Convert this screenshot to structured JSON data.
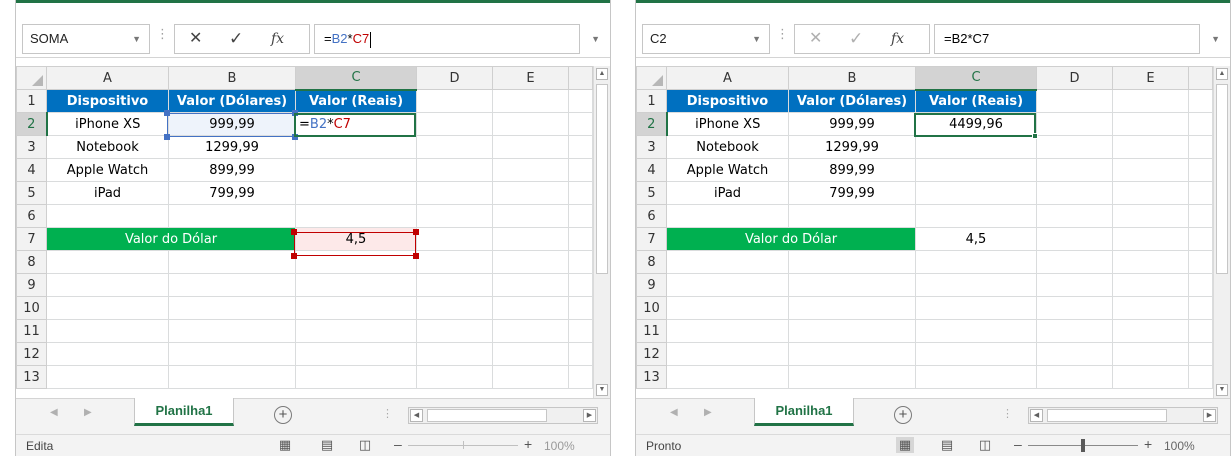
{
  "colors": {
    "excel_green": "#217346",
    "header_blue": "#0070c0",
    "dollar_green": "#00b050",
    "ref_blue": "#4472c4",
    "ref_red": "#c00000",
    "ref_red_fill": "#fde9e9"
  },
  "icons": [
    "cancel-icon",
    "enter-check-icon",
    "insert-function-icon",
    "expand-formula-bar-icon",
    "add-sheet-icon",
    "normal-view-icon",
    "page-layout-icon",
    "page-break-icon"
  ],
  "left": {
    "namebox": "SOMA",
    "formula_parts": [
      {
        "text": "=",
        "color": "#000000"
      },
      {
        "text": "B2",
        "color": "#4472c4"
      },
      {
        "text": "*",
        "color": "#000000"
      },
      {
        "text": "C7",
        "color": "#c00000"
      }
    ],
    "columns": [
      "A",
      "B",
      "C",
      "D",
      "E"
    ],
    "rows": [
      "1",
      "2",
      "3",
      "4",
      "5",
      "6",
      "7",
      "8",
      "9",
      "10",
      "11",
      "12",
      "13"
    ],
    "cells": {
      "a1": "Dispositivo",
      "b1": "Valor (Dólares)",
      "c1": "Valor (Reais)",
      "a2": "iPhone XS",
      "b2": "999,99",
      "c2_parts": [
        {
          "text": "=",
          "color": "#000000"
        },
        {
          "text": "B2",
          "color": "#4472c4"
        },
        {
          "text": "*",
          "color": "#000000"
        },
        {
          "text": "C7",
          "color": "#c00000"
        }
      ],
      "a3": "Notebook",
      "b3": "1299,99",
      "a4": "Apple Watch",
      "b4": "899,99",
      "a5": "iPad",
      "b5": "799,99",
      "a7": "Valor do Dólar",
      "c7": "4,5"
    },
    "sheet_tab": "Planilha1",
    "status": "Edita",
    "zoom": "100%",
    "zoom_slider_visible": false
  },
  "right": {
    "namebox": "C2",
    "formula": "=B2*C7",
    "columns": [
      "A",
      "B",
      "C",
      "D",
      "E"
    ],
    "rows": [
      "1",
      "2",
      "3",
      "4",
      "5",
      "6",
      "7",
      "8",
      "9",
      "10",
      "11",
      "12",
      "13"
    ],
    "cells": {
      "a1": "Dispositivo",
      "b1": "Valor (Dólares)",
      "c1": "Valor (Reais)",
      "a2": "iPhone XS",
      "b2": "999,99",
      "c2": "4499,96",
      "a3": "Notebook",
      "b3": "1299,99",
      "a4": "Apple Watch",
      "b4": "899,99",
      "a5": "iPad",
      "b5": "799,99",
      "a7": "Valor do Dólar",
      "c7": "4,5"
    },
    "sheet_tab": "Planilha1",
    "status": "Pronto",
    "zoom": "100%",
    "zoom_level": 1.0
  }
}
